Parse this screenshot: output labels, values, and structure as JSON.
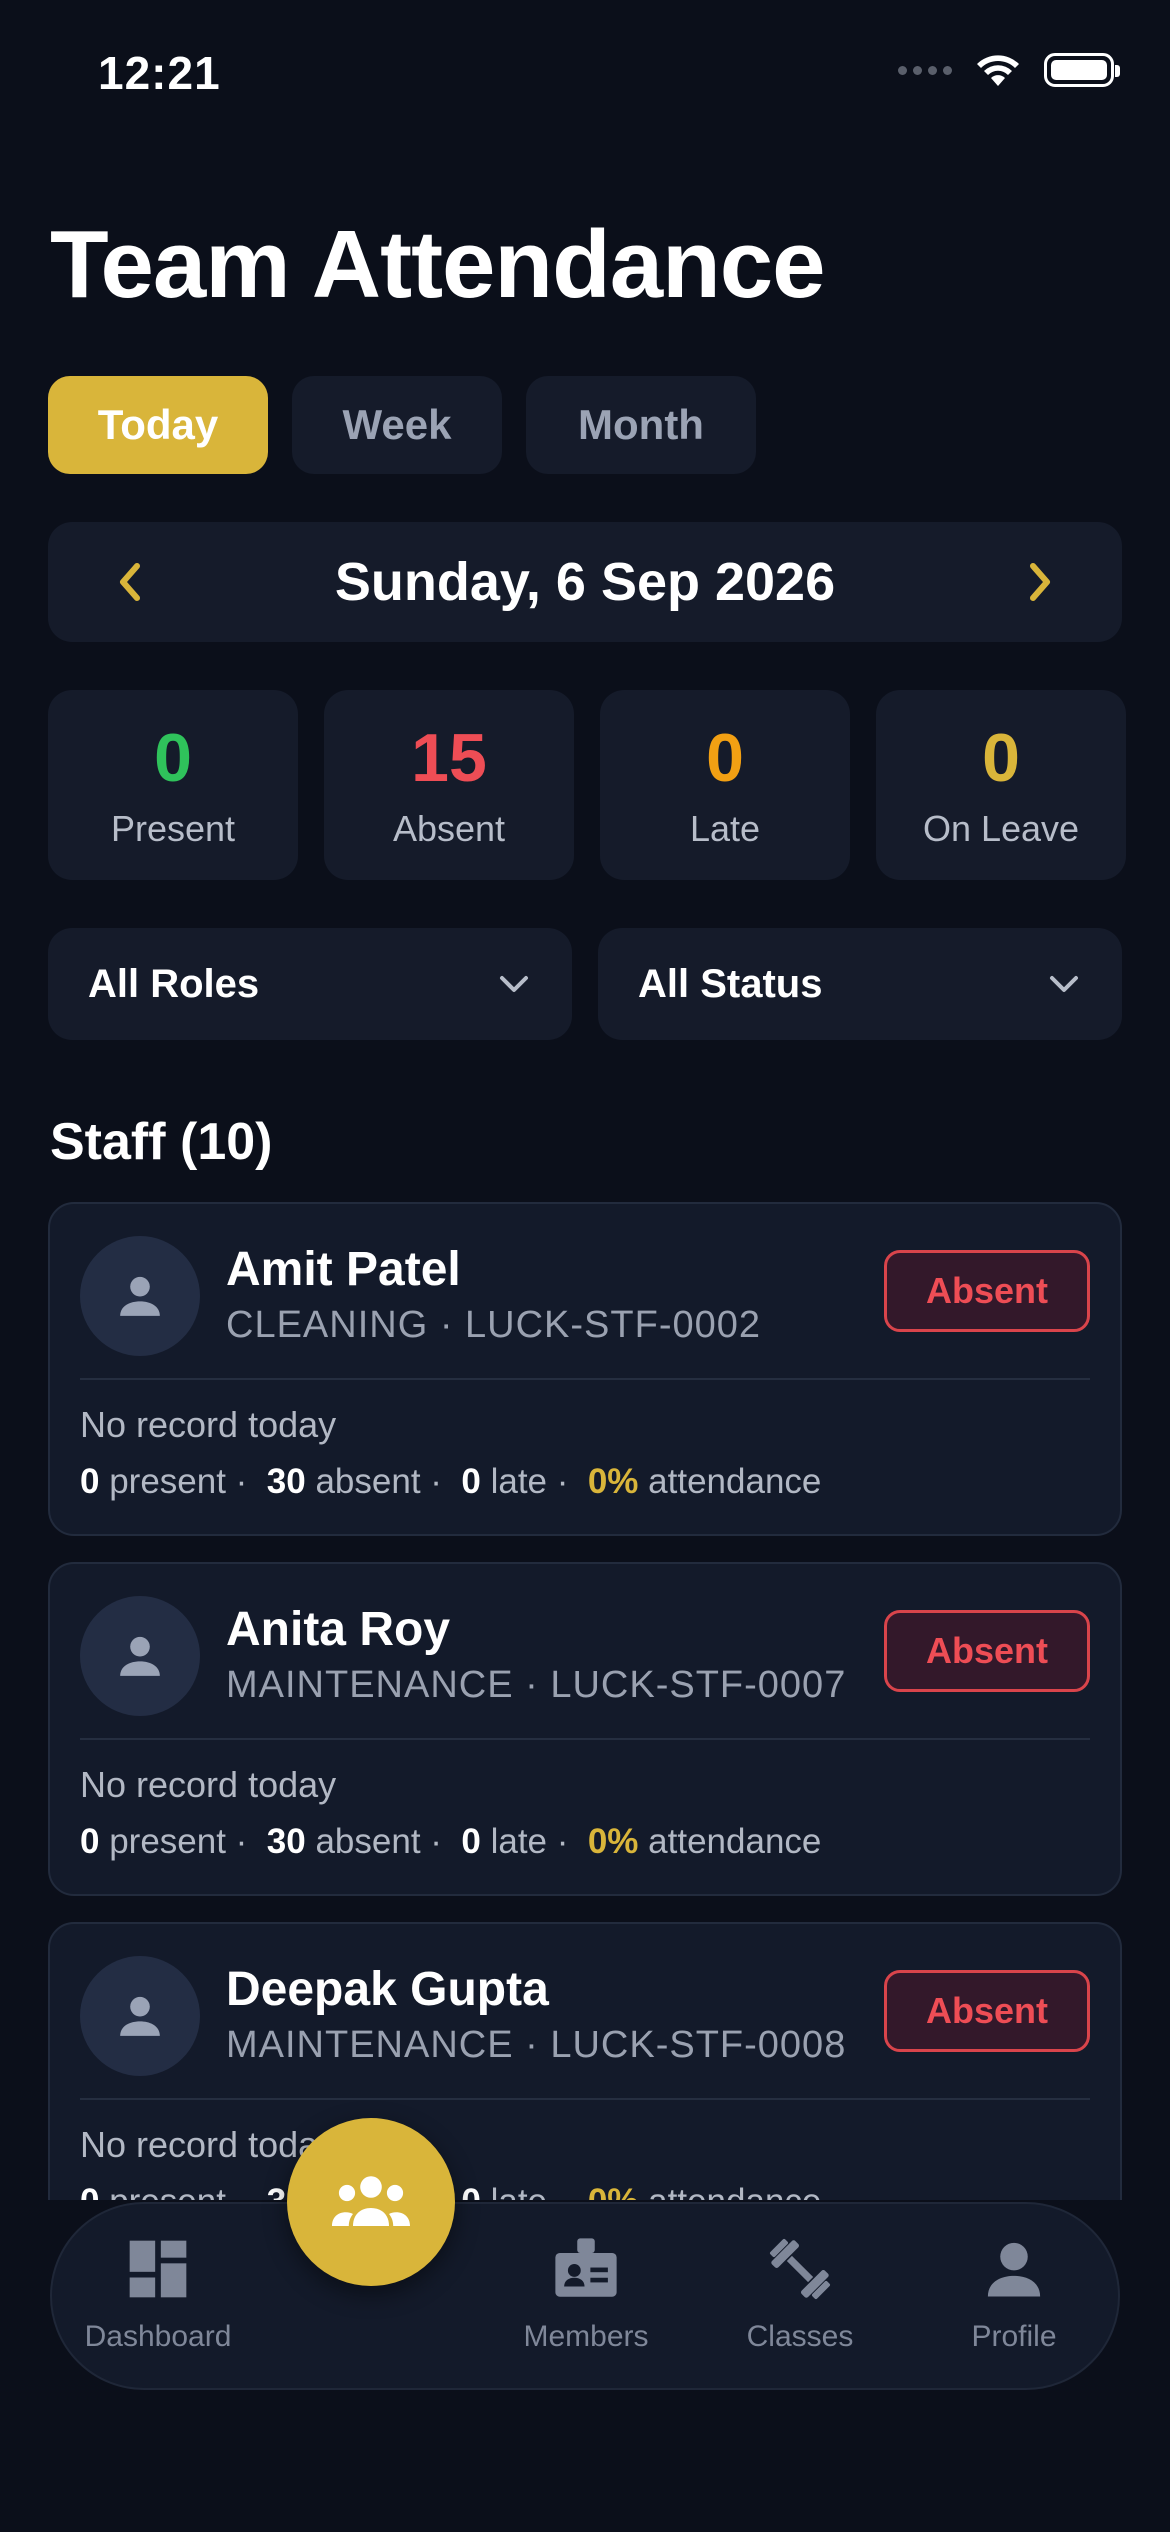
{
  "status_bar": {
    "time": "12:21"
  },
  "header": {
    "title": "Team Attendance"
  },
  "tabs": [
    {
      "label": "Today",
      "active": true
    },
    {
      "label": "Week",
      "active": false
    },
    {
      "label": "Month",
      "active": false
    }
  ],
  "date_nav": {
    "date": "Sunday, 6 Sep 2026",
    "prev_icon": "chevron-left-icon",
    "next_icon": "chevron-right-icon"
  },
  "stats": [
    {
      "value": "0",
      "label": "Present",
      "color": "#2fc25b"
    },
    {
      "value": "15",
      "label": "Absent",
      "color": "#ee4d55"
    },
    {
      "value": "0",
      "label": "Late",
      "color": "#f2a013"
    },
    {
      "value": "0",
      "label": "On Leave",
      "color": "#d9b53a"
    }
  ],
  "filters": {
    "role": {
      "selected": "All Roles"
    },
    "status": {
      "selected": "All Status"
    }
  },
  "staff_section": {
    "heading": "Staff (10)"
  },
  "staff": [
    {
      "name": "Amit Patel",
      "meta": "CLEANING · LUCK-STF-0002",
      "status": "Absent",
      "record": "No record today",
      "present": "0",
      "present_label": "present",
      "absent": "30",
      "absent_label": "absent",
      "late": "0",
      "late_label": "late",
      "pct": "0%",
      "pct_label": "attendance"
    },
    {
      "name": "Anita Roy",
      "meta": "MAINTENANCE · LUCK-STF-0007",
      "status": "Absent",
      "record": "No record today",
      "present": "0",
      "present_label": "present",
      "absent": "30",
      "absent_label": "absent",
      "late": "0",
      "late_label": "late",
      "pct": "0%",
      "pct_label": "attendance"
    },
    {
      "name": "Deepak Gupta",
      "meta": "MAINTENANCE · LUCK-STF-0008",
      "status": "Absent",
      "record": "No record today",
      "present": "0",
      "present_label": "present",
      "absent": "30",
      "absent_label": "absent",
      "late": "0",
      "late_label": "late",
      "pct": "0%",
      "pct_label": "attendance"
    }
  ],
  "bottom_nav": [
    {
      "label": "Dashboard",
      "icon": "dashboard-icon"
    },
    {
      "label": "Members",
      "icon": "id-badge-icon"
    },
    {
      "label": "Classes",
      "icon": "dumbbell-icon"
    },
    {
      "label": "Profile",
      "icon": "person-icon"
    }
  ],
  "fab": {
    "icon": "team-icon"
  },
  "colors": {
    "accent": "#d9b53a",
    "background": "#0b0f1a",
    "card": "#151b2a",
    "absent": "#ee4d55"
  }
}
